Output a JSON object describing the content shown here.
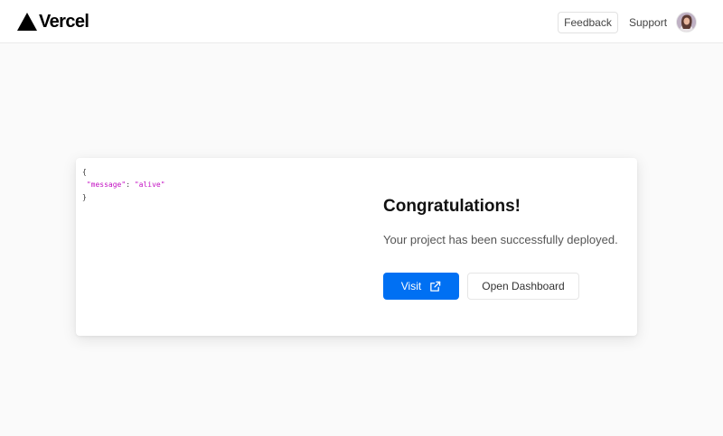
{
  "header": {
    "logo_text": "Vercel",
    "feedback_label": "Feedback",
    "support_label": "Support"
  },
  "icons": {
    "logo": "vercel-triangle-icon",
    "avatar": "user-avatar",
    "visit": "external-link-icon"
  },
  "preview": {
    "open_brace": "{",
    "key": "\"message\"",
    "separator": ": ",
    "value": "\"alive\"",
    "close_brace": "}"
  },
  "main": {
    "title": "Congratulations!",
    "subtitle": "Your project has been successfully deployed.",
    "visit_label": "Visit",
    "dashboard_label": "Open Dashboard"
  },
  "colors": {
    "accent": "#0070f3",
    "json_highlight": "#c311c3",
    "page_background": "#fafafa"
  }
}
